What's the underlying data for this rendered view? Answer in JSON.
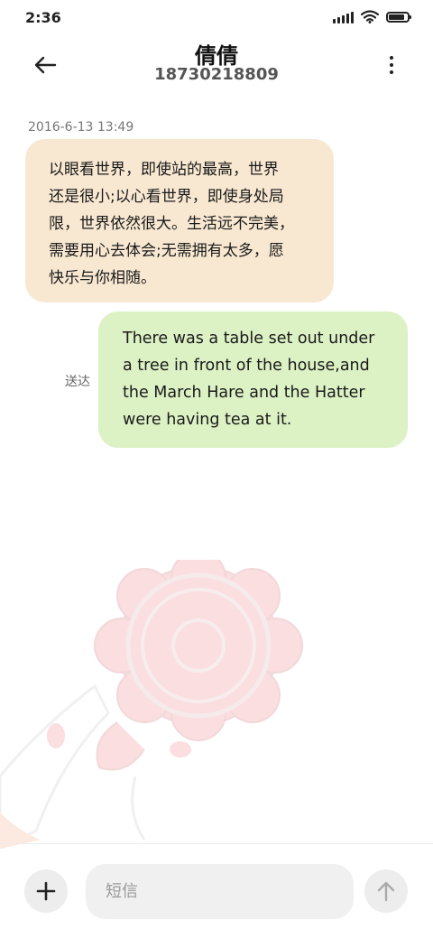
{
  "status_bar": {
    "time": "2:36",
    "battery_level": 0.85
  },
  "header": {
    "contact_name": "倩倩",
    "contact_number": "18730218809",
    "back_icon": "arrow-left-icon",
    "more_icon": "more-vertical-icon"
  },
  "conversation": {
    "timestamp": "2016-6-13 13:49",
    "messages": [
      {
        "direction": "incoming",
        "text": "以眼看世界，即使站的最高，世界\n还是很小;以心看世界，即使身处局\n限，世界依然很大。生活远不完美，\n需要用心去体会;无需拥有太多，愿\n快乐与你相随。",
        "color": "#f8e8d2"
      },
      {
        "direction": "outgoing",
        "text": "There was a table set out under\na tree in front of the house,and\nthe March Hare and the Hatter\nwere having tea at it.",
        "status": "送达",
        "color": "#dcf1c4"
      }
    ]
  },
  "composer": {
    "placeholder": "短信",
    "value": "",
    "add_icon": "plus-icon",
    "send_icon": "arrow-up-icon"
  },
  "background": {
    "art": "mooncake-illustration"
  }
}
